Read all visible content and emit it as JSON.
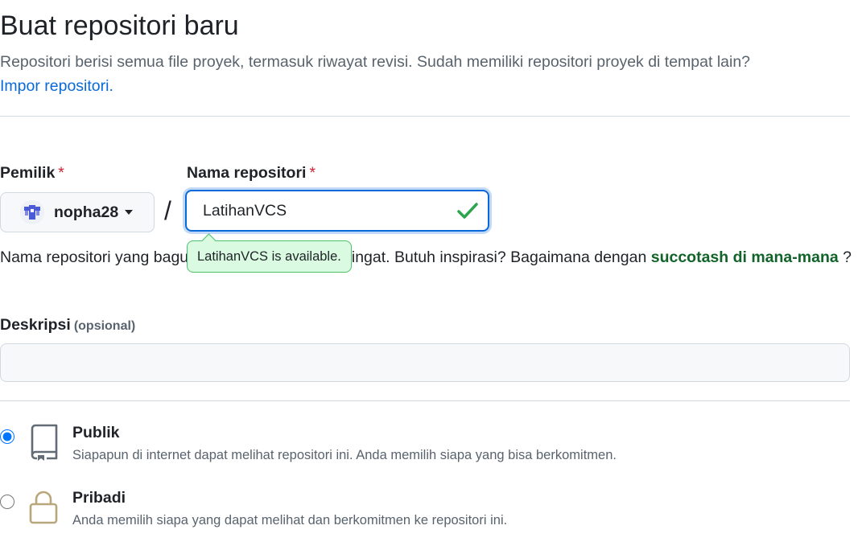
{
  "header": {
    "title": "Buat repositori baru",
    "subtitle": "Repositori berisi semua file proyek, termasuk riwayat revisi. Sudah memiliki repositori proyek di tempat lain?",
    "import_link": "Impor repositori."
  },
  "owner": {
    "label": "Pemilik",
    "required_mark": "*",
    "selected": "nopha28"
  },
  "separator": "/",
  "repo_name": {
    "label": "Nama repositori",
    "required_mark": "*",
    "value": "LatihanVCS",
    "availability": "LatihanVCS is available."
  },
  "hint": {
    "prefix": "Nama repositori yang bagus pendek dan mudah diingat. Butuh inspirasi? Bagaimana dengan",
    "suggestion": "succotash di mana-mana",
    "suffix": "?"
  },
  "description": {
    "label": "Deskripsi",
    "optional": "(opsional)",
    "value": ""
  },
  "visibility": {
    "selected": "public",
    "options": [
      {
        "title": "Publik",
        "description": "Siapapun di internet dapat melihat repositori ini. Anda memilih siapa yang bisa berkomitmen.",
        "icon": "repo-icon"
      },
      {
        "title": "Pribadi",
        "description": "Anda memilih siapa yang dapat melihat dan berkomitmen ke repositori ini.",
        "icon": "lock-icon"
      }
    ]
  },
  "colors": {
    "link": "#0969da",
    "success": "#1a7f37",
    "required": "#d1242f",
    "lock_icon": "#bf8700"
  }
}
